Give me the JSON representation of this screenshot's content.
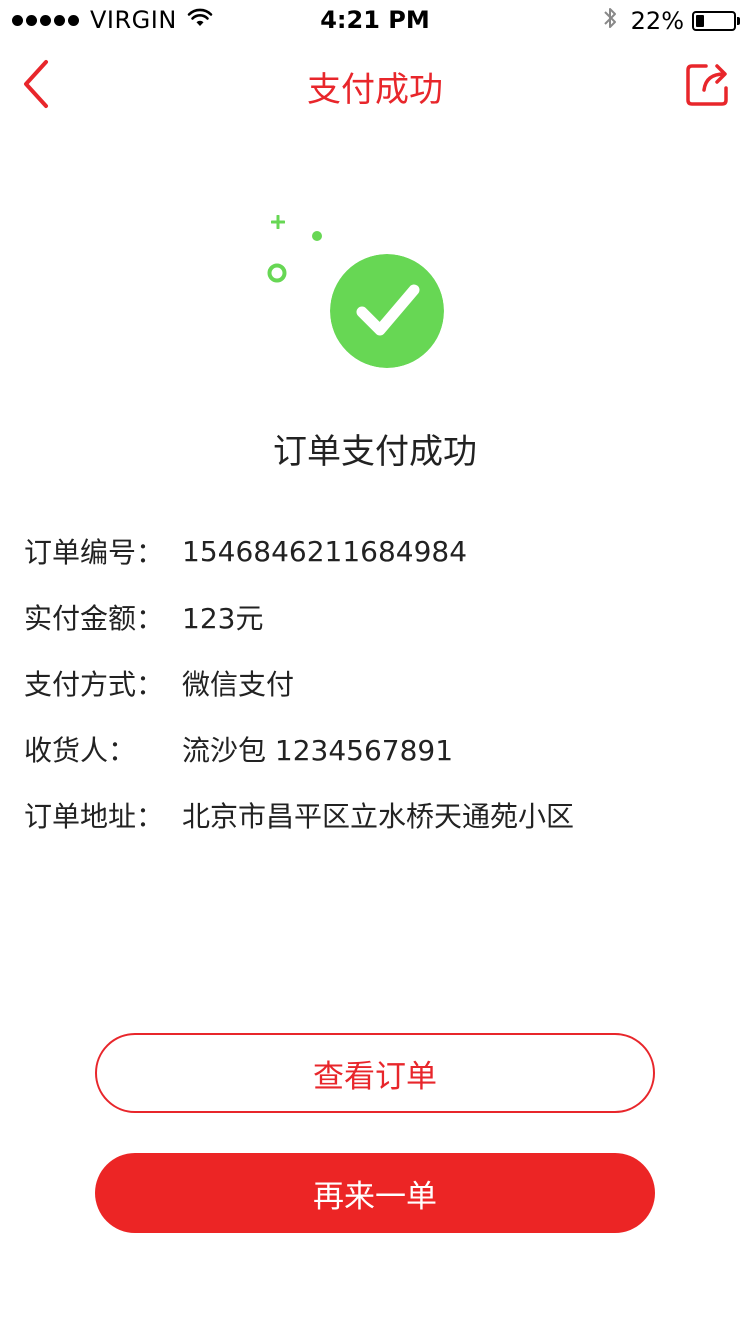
{
  "status_bar": {
    "carrier": "VIRGIN",
    "time": "4:21 PM",
    "battery": "22%",
    "battery_level": 0.22,
    "signal_strength": 5,
    "icons": [
      "signal-dots-icon",
      "wifi-icon",
      "bluetooth-icon",
      "battery-icon"
    ]
  },
  "nav": {
    "title": "支付成功",
    "back_icon": "chevron-left-icon",
    "share_icon": "share-icon",
    "accent_color": "#e8262b"
  },
  "success": {
    "icon": "check-circle-icon",
    "icon_color": "#67d754",
    "title": "订单支付成功"
  },
  "order_info": [
    {
      "label": "订单编号：",
      "value": "1546846211684984"
    },
    {
      "label": "实付金额：",
      "value": "123元"
    },
    {
      "label": "支付方式：",
      "value": "微信支付"
    },
    {
      "label": "收货人：",
      "value": "流沙包 1234567891"
    },
    {
      "label": "订单地址：",
      "value": "北京市昌平区立水桥天通苑小区"
    }
  ],
  "actions": {
    "view_order": "查看订单",
    "reorder": "再来一单",
    "primary_color": "#ec2525"
  }
}
